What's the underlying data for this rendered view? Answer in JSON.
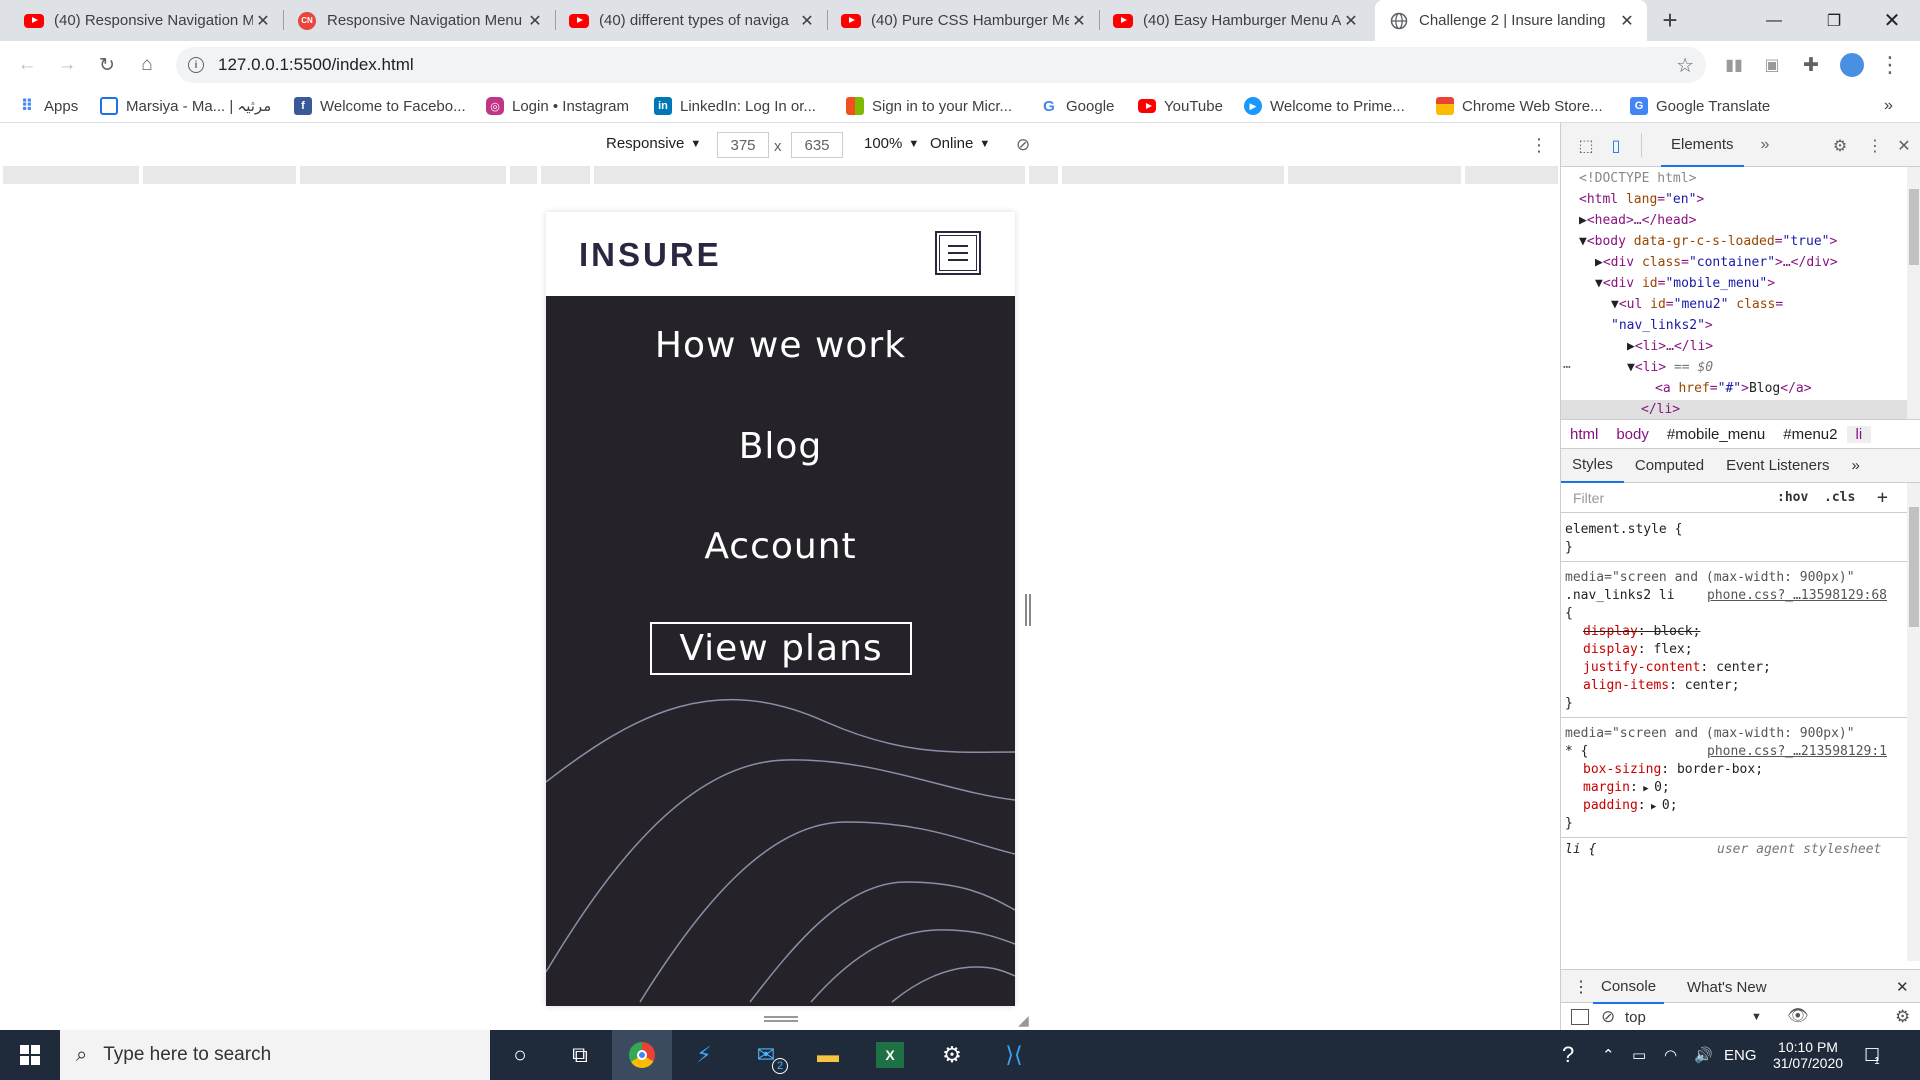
{
  "browser": {
    "tabs": [
      {
        "title": "(40) Responsive Navigation M",
        "icon": "youtube-icon"
      },
      {
        "title": "Responsive Navigation Menu",
        "icon": "codingnepal-icon"
      },
      {
        "title": "(40) different types of naviga",
        "icon": "youtube-icon"
      },
      {
        "title": "(40) Pure CSS Hamburger Me",
        "icon": "youtube-icon"
      },
      {
        "title": "(40) Easy Hamburger Menu A",
        "icon": "youtube-icon"
      },
      {
        "title": "Challenge 2 | Insure landing",
        "icon": "globe-icon",
        "active": true
      }
    ],
    "new_tab": "+",
    "url": "127.0.0.1:5500/index.html",
    "bookmarks": [
      {
        "label": "Apps",
        "icon": "apps-grid-icon"
      },
      {
        "label": "Marsiya - Ma... | مرثیہ",
        "icon": "table-icon"
      },
      {
        "label": "Welcome to Facebo...",
        "icon": "facebook-icon"
      },
      {
        "label": "Login • Instagram",
        "icon": "instagram-icon"
      },
      {
        "label": "LinkedIn: Log In or...",
        "icon": "linkedin-icon"
      },
      {
        "label": "Sign in to your Micr...",
        "icon": "microsoft-icon"
      },
      {
        "label": "Google",
        "icon": "google-icon"
      },
      {
        "label": "YouTube",
        "icon": "youtube-icon"
      },
      {
        "label": "Welcome to Prime...",
        "icon": "prime-icon"
      },
      {
        "label": "Chrome Web Store...",
        "icon": "webstore-icon"
      },
      {
        "label": "Google Translate",
        "icon": "translate-icon"
      }
    ],
    "more_bookmarks": "»"
  },
  "device_toolbar": {
    "mode": "Responsive",
    "width": "375",
    "times": "x",
    "height": "635",
    "zoom": "100%",
    "network": "Online"
  },
  "page": {
    "logo": "INSURE",
    "menu": [
      "How we work",
      "Blog",
      "Account"
    ],
    "cta": "View plans",
    "colors": {
      "bg": "#252329",
      "wave": "#8c8ea8",
      "text": "#ffffff",
      "logo": "#2d2640"
    }
  },
  "devtools": {
    "main_tab": "Elements",
    "more": "»",
    "dom": {
      "doctype": "<!DOCTYPE html>",
      "html_tag": "<html",
      "html_lang_attr": "lang",
      "html_lang_val": "\"en\"",
      "close_bracket": ">",
      "head": "<head>…</head>",
      "body_tag": "<body",
      "body_attr": "data-gr-c-s-loaded",
      "body_val": "\"true\"",
      "div1_tag": "<div",
      "div1_attr": "class",
      "div1_val": "\"container\"",
      "div1_close": ">…</div>",
      "div2_tag": "<div",
      "div2_attr": "id",
      "div2_val": "\"mobile_menu\"",
      "ul_tag": "<ul",
      "ul_id_attr": "id",
      "ul_id_val": "\"menu2\"",
      "ul_class_attr": "class",
      "ul_class_val": "\"nav_links2\"",
      "li_collapsed": "<li>…</li>",
      "li_open": "<li>",
      "li_eq": "== $0",
      "a_tag": "<a",
      "a_attr": "href",
      "a_val": "\"#\"",
      "a_text": "Blog",
      "a_close": "</a>",
      "li_close": "</li>",
      "eq": "="
    },
    "breadcrumbs": [
      "html",
      "body",
      "#mobile_menu",
      "#menu2",
      "li"
    ],
    "style_tabs": [
      "Styles",
      "Computed",
      "Event Listeners",
      "»"
    ],
    "filter_placeholder": "Filter",
    "hov": ":hov",
    "cls": ".cls",
    "plus": "+",
    "rules": {
      "element_style": "element.style {",
      "brace_close": "}",
      "brace_open": "{",
      "media1": "media=\"screen and (max-width: 900px)\"",
      "selector1": ".nav_links2 li",
      "source1": "phone.css?_…13598129:68",
      "r1p1": "display",
      "r1v1": "block;",
      "r1p2": "display",
      "r1v2": "flex;",
      "r1p3": "justify-content",
      "r1v3": "center;",
      "r1p4": "align-items",
      "r1v4": "center;",
      "media2": "media=\"screen and (max-width: 900px)\"",
      "selector2": "* {",
      "source2": "phone.css?_…213598129:1",
      "r2p1": "box-sizing",
      "r2v1": "border-box;",
      "r2p2": "margin",
      "r2v2": "0;",
      "r2p3": "padding",
      "r2v3": "0;",
      "ua_selector": "li {",
      "ua_source": "user agent stylesheet"
    },
    "console_tabs": [
      "Console",
      "What's New"
    ],
    "context": "top",
    "prompt": ">"
  },
  "taskbar": {
    "search_placeholder": "Type here to search",
    "lang": "ENG",
    "time": "10:10 PM",
    "date": "31/07/2020",
    "mail_badge": "2",
    "notif_count": "1"
  }
}
